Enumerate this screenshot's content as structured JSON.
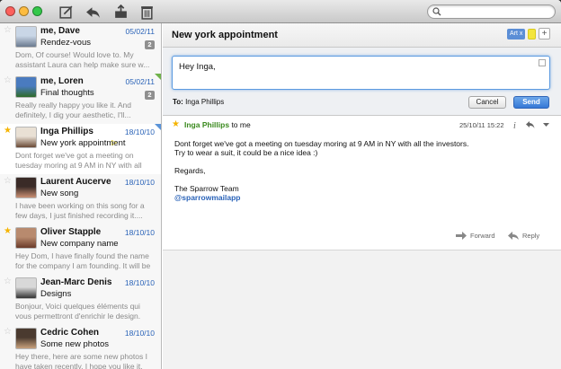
{
  "toolbar": {
    "traffic_colors": [
      "#fc615d",
      "#fdbc40",
      "#34c84a"
    ],
    "icons": [
      "compose-icon",
      "reply-icon",
      "archive-icon",
      "trash-icon"
    ],
    "search": {
      "value": "",
      "placeholder": ""
    }
  },
  "messages": [
    {
      "sender": "me, Dave",
      "date": "05/02/11",
      "subject": "Rendez-vous",
      "preview": "Dom, Of course! Would love to. My assistant Laura can help make sure w...",
      "count": "2",
      "starred": false,
      "avatar_colors": [
        "#c9d6e6",
        "#6b7a8f"
      ]
    },
    {
      "sender": "me, Loren",
      "date": "05/02/11",
      "subject": "Final thoughts",
      "preview": "Really really happy you like it. And definitely, I dig your aesthetic, I'll...",
      "count": "2",
      "starred": false,
      "avatar_colors": [
        "#4a7bbf",
        "#2f6b2a"
      ]
    },
    {
      "sender": "Inga Phillips",
      "date": "18/10/10",
      "subject": "New york appointment",
      "preview": "Dont forget we've got a meeting on tuesday moring at 9 AM in NY with all the investor...",
      "count": "",
      "starred": true,
      "avatar_colors": [
        "#e9e0d4",
        "#6a4a36"
      ]
    },
    {
      "sender": "Laurent Aucerve",
      "date": "18/10/10",
      "subject": "New song",
      "preview": "I have been working on this song for a few days, I just finished recording it....",
      "count": "",
      "starred": false,
      "avatar_colors": [
        "#3a2b27",
        "#c98f73"
      ]
    },
    {
      "sender": "Oliver Stapple",
      "date": "18/10/10",
      "subject": "New company name",
      "preview": "Hey Dom, I have finally found the name for the company I am founding. It will be calle...",
      "count": "",
      "starred": true,
      "avatar_colors": [
        "#b88a6e",
        "#6b3b2a"
      ]
    },
    {
      "sender": "Jean-Marc Denis",
      "date": "18/10/10",
      "subject": "Designs",
      "preview": "Bonjour, Voici quelques éléments qui vous permettront d'enrichir le design. Vous trouvere...",
      "count": "",
      "starred": false,
      "avatar_colors": [
        "#d8d8d8",
        "#333333"
      ]
    },
    {
      "sender": "Cedric Cohen",
      "date": "18/10/10",
      "subject": "Some new photos",
      "preview": "Hey there, here are some new photos I have taken recently. I hope you like it. Do...",
      "count": "",
      "starred": false,
      "avatar_colors": [
        "#4a3a2f",
        "#c8a07c"
      ]
    }
  ],
  "conversation": {
    "title": "New york appointment",
    "label": "Art",
    "label_close": "x",
    "add_label": "+",
    "reply_text": "Hey Inga,",
    "to_prefix": "To:",
    "to_name": "Inga Phillips",
    "cancel_label": "Cancel",
    "send_label": "Send",
    "from_name": "Inga Phillips",
    "from_suffix": "to me",
    "date": "25/10/11 15:22",
    "body": [
      "Dont forget we've got a meeting on tuesday moring at 9 AM in NY with all the investors.",
      "Try to wear a suit, it could be a nice idea :)",
      "",
      "Regards,",
      "",
      "The Sparrow Team"
    ],
    "link": "@sparrowmailapp",
    "forward_label": "Forward",
    "reply_label": "Reply"
  },
  "colors": {
    "accent": "#3578d6",
    "sender_green": "#3a8a1e",
    "date_blue": "#2a63b8",
    "star": "#f5b400"
  }
}
